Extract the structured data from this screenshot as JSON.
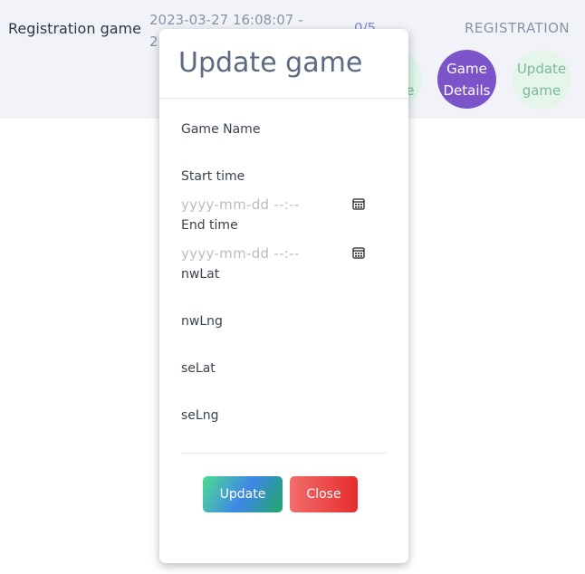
{
  "row": {
    "name": "Registration game",
    "time_line1": "2023-03-27 16:08:07 -",
    "time_line2": "2",
    "count": "0/5",
    "status": "REGISTRATION",
    "hidden_button_line1": "",
    "hidden_button_line2": "e",
    "details_button_line1": "Game",
    "details_button_line2": "Details",
    "update_button_line1": "Update",
    "update_button_line2": "game"
  },
  "modal": {
    "title": "Update game",
    "fields": {
      "game_name_label": "Game Name",
      "start_time_label": "Start time",
      "start_time_placeholder": "yyyy-mm-dd --:--",
      "end_time_label": "End time",
      "end_time_placeholder": "yyyy-mm-dd --:--",
      "nwlat_label": "nwLat",
      "nwlng_label": "nwLng",
      "selat_label": "seLat",
      "selng_label": "seLng"
    },
    "update_label": "Update",
    "close_label": "Close"
  },
  "colors": {
    "row_background": "#f1f3f9",
    "details_button": "#7b54c9",
    "update_button_gradient": [
      "#4ddc8f",
      "#3f86e8",
      "#1fa865"
    ],
    "close_button_gradient": [
      "#f26d6d",
      "#e62c2c"
    ]
  },
  "icons": {
    "date_picker": "calendar-icon"
  }
}
